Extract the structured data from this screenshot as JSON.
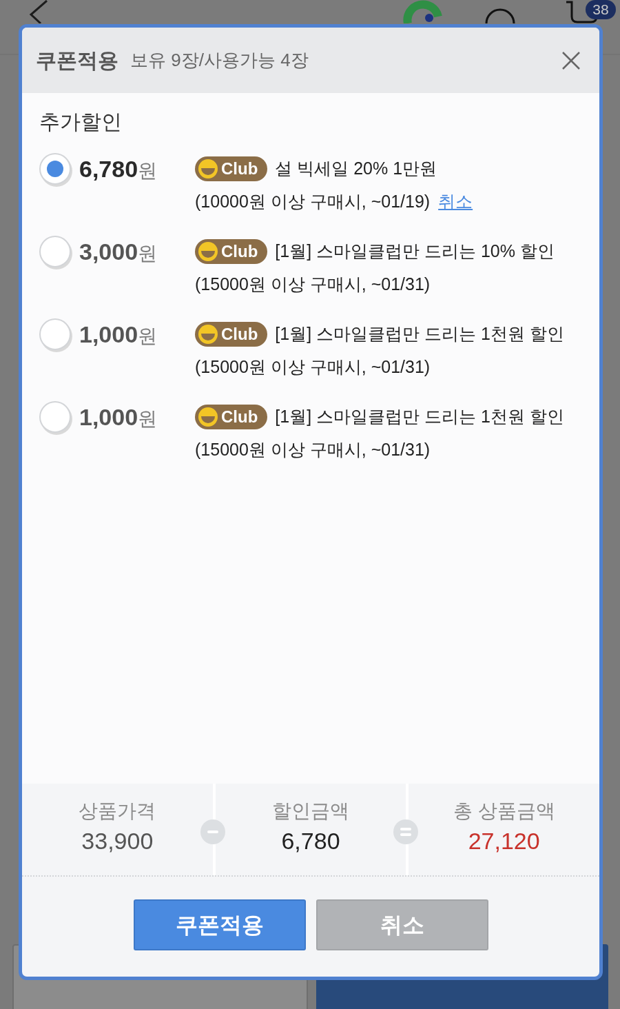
{
  "page": {
    "cart_badge": "38"
  },
  "dialog": {
    "title": "쿠폰적용",
    "subtitle": "보유 9장/사용가능 4장",
    "section_title": "추가할인",
    "coupons": [
      {
        "amount": "**6,780**원",
        "badge": "Club",
        "name": "설 빅세일 20% 1만원",
        "condition": "(10000원 이상 구매시, ~01/19)",
        "cancel_link": "취소",
        "selected": true
      },
      {
        "amount": "**3,000**원",
        "badge": "Club",
        "name": "[1월] 스마일클럽만 드리는 10% 할인",
        "condition": "(15000원 이상 구매시, ~01/31)",
        "selected": false
      },
      {
        "amount": "**1,000**원",
        "badge": "Club",
        "name": "[1월] 스마일클럽만 드리는 1천원 할인",
        "condition": "(15000원 이상 구매시, ~01/31)",
        "selected": false
      },
      {
        "amount": "**1,000**원",
        "badge": "Club",
        "name": "[1월] 스마일클럽만 드리는 1천원 할인",
        "condition": "(15000원 이상 구매시, ~01/31)",
        "selected": false
      }
    ],
    "summary": [
      {
        "kind": "price",
        "label": "상품가격",
        "value": "33,900"
      },
      {
        "kind": "discount",
        "label": "할인금액",
        "value": "6,780"
      },
      {
        "kind": "total",
        "label": "총 상품금액",
        "value": "27,120"
      }
    ],
    "buttons": [
      {
        "kind": "primary",
        "label": "쿠폰적용"
      },
      {
        "kind": "secondary",
        "label": "취소"
      }
    ]
  }
}
